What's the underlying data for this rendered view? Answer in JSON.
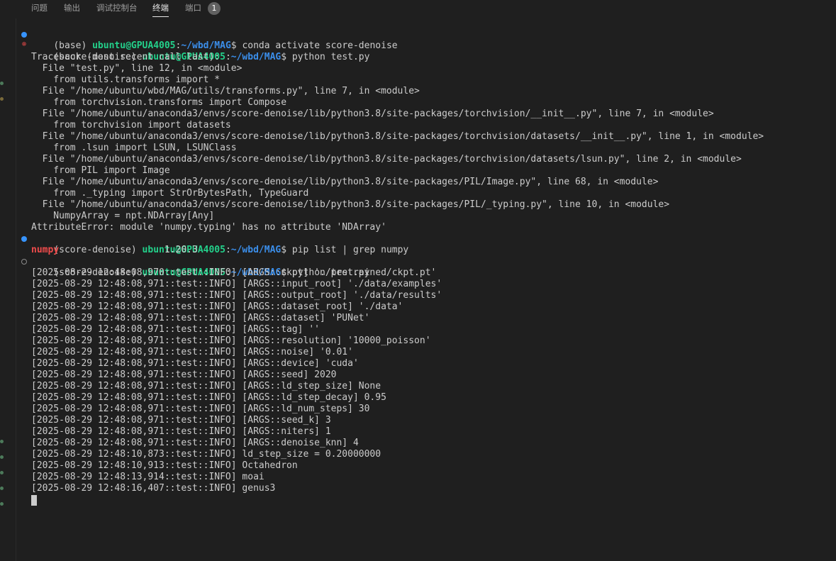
{
  "tabs": [
    {
      "label": "问题"
    },
    {
      "label": "输出"
    },
    {
      "label": "调试控制台"
    },
    {
      "label": "终端",
      "active": true
    },
    {
      "label": "端口"
    }
  ],
  "ports_badge": "1",
  "prompts": [
    {
      "env": "(base) ",
      "user": "ubuntu@GPUA4005",
      "sep": ":",
      "path": "~/wbd/MAG",
      "cmd": "$ conda activate score-denoise"
    },
    {
      "env": "(score-denoise) ",
      "user": "ubuntu@GPUA4005",
      "sep": ":",
      "path": "~/wbd/MAG",
      "cmd": "$ python test.py"
    },
    {
      "env": "(score-denoise) ",
      "user": "ubuntu@GPUA4005",
      "sep": ":",
      "path": "~/wbd/MAG",
      "cmd": "$ pip list | grep numpy"
    },
    {
      "env": "(score-denoise) ",
      "user": "ubuntu@GPUA4005",
      "sep": ":",
      "path": "~/wbd/MAG",
      "cmd": "$ python test.py"
    }
  ],
  "traceback": [
    "Traceback (most recent call last):",
    "  File \"test.py\", line 12, in <module>",
    "    from utils.transforms import *",
    "  File \"/home/ubuntu/wbd/MAG/utils/transforms.py\", line 7, in <module>",
    "    from torchvision.transforms import Compose",
    "  File \"/home/ubuntu/anaconda3/envs/score-denoise/lib/python3.8/site-packages/torchvision/__init__.py\", line 7, in <module>",
    "    from torchvision import datasets",
    "  File \"/home/ubuntu/anaconda3/envs/score-denoise/lib/python3.8/site-packages/torchvision/datasets/__init__.py\", line 1, in <module>",
    "    from .lsun import LSUN, LSUNClass",
    "  File \"/home/ubuntu/anaconda3/envs/score-denoise/lib/python3.8/site-packages/torchvision/datasets/lsun.py\", line 2, in <module>",
    "    from PIL import Image",
    "  File \"/home/ubuntu/anaconda3/envs/score-denoise/lib/python3.8/site-packages/PIL/Image.py\", line 68, in <module>",
    "    from ._typing import StrOrBytesPath, TypeGuard",
    "  File \"/home/ubuntu/anaconda3/envs/score-denoise/lib/python3.8/site-packages/PIL/_typing.py\", line 10, in <module>",
    "    NumpyArray = npt.NDArray[Any]",
    "AttributeError: module 'numpy.typing' has no attribute 'NDArray'"
  ],
  "pip_result": {
    "name": "numpy",
    "spacing": "                   ",
    "version": "1.20.3"
  },
  "log_lines": [
    "[2025-08-29 12:48:08,970::test::INFO] [ARGS::ckpt] './pretrained/ckpt.pt'",
    "[2025-08-29 12:48:08,971::test::INFO] [ARGS::input_root] './data/examples'",
    "[2025-08-29 12:48:08,971::test::INFO] [ARGS::output_root] './data/results'",
    "[2025-08-29 12:48:08,971::test::INFO] [ARGS::dataset_root] './data'",
    "[2025-08-29 12:48:08,971::test::INFO] [ARGS::dataset] 'PUNet'",
    "[2025-08-29 12:48:08,971::test::INFO] [ARGS::tag] ''",
    "[2025-08-29 12:48:08,971::test::INFO] [ARGS::resolution] '10000_poisson'",
    "[2025-08-29 12:48:08,971::test::INFO] [ARGS::noise] '0.01'",
    "[2025-08-29 12:48:08,971::test::INFO] [ARGS::device] 'cuda'",
    "[2025-08-29 12:48:08,971::test::INFO] [ARGS::seed] 2020",
    "[2025-08-29 12:48:08,971::test::INFO] [ARGS::ld_step_size] None",
    "[2025-08-29 12:48:08,971::test::INFO] [ARGS::ld_step_decay] 0.95",
    "[2025-08-29 12:48:08,971::test::INFO] [ARGS::ld_num_steps] 30",
    "[2025-08-29 12:48:08,971::test::INFO] [ARGS::seed_k] 3",
    "[2025-08-29 12:48:08,971::test::INFO] [ARGS::niters] 1",
    "[2025-08-29 12:48:08,971::test::INFO] [ARGS::denoise_knn] 4",
    "[2025-08-29 12:48:10,873::test::INFO] ld_step_size = 0.20000000",
    "[2025-08-29 12:48:10,913::test::INFO] Octahedron",
    "[2025-08-29 12:48:13,914::test::INFO] moai",
    "[2025-08-29 12:48:16,407::test::INFO] genus3"
  ],
  "colors": {
    "background": "#1f1f1f",
    "user": "#23d18b",
    "path": "#3b8eea",
    "error": "#f14c4c",
    "success_dot": "#3794ff"
  }
}
